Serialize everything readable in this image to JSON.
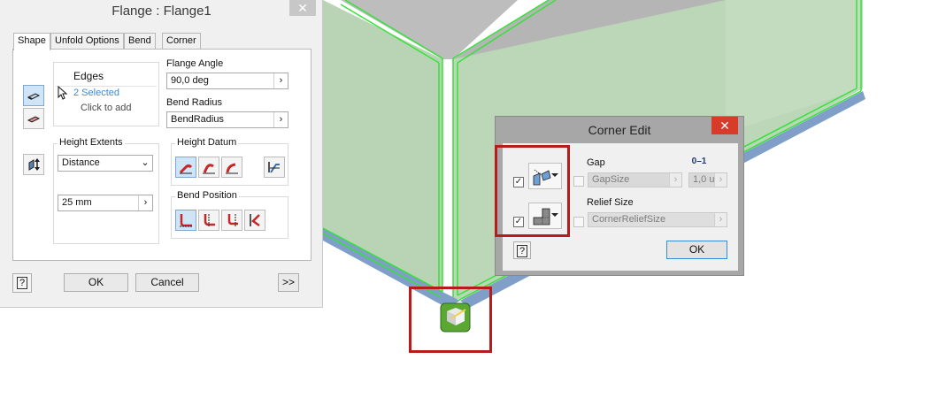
{
  "flange_dialog": {
    "title": "Flange : Flange1",
    "close_glyph": "✕",
    "tabs": [
      {
        "label": "Shape",
        "active": true
      },
      {
        "label": "Unfold Options",
        "active": false
      },
      {
        "label": "Bend",
        "active": false
      },
      {
        "label": "Corner",
        "active": false
      }
    ],
    "edges": {
      "header": "Edges",
      "selected": "2 Selected",
      "click_to_add": "Click to add"
    },
    "flange_angle": {
      "label": "Flange Angle",
      "value": "90,0 deg"
    },
    "bend_radius": {
      "label": "Bend Radius",
      "value": "BendRadius"
    },
    "height_extents": {
      "label": "Height Extents",
      "selected": "Distance",
      "distance_value": "25 mm"
    },
    "height_datum": {
      "label": "Height Datum"
    },
    "bend_position": {
      "label": "Bend Position"
    },
    "buttons": {
      "ok": "OK",
      "cancel": "Cancel",
      "more": ">>"
    },
    "help_glyph": "?"
  },
  "corner_edit": {
    "title": "Corner Edit",
    "close_glyph": "✕",
    "gap": {
      "label": "Gap",
      "value": "GapSize",
      "secondary_value": "1,0 u"
    },
    "relief_size": {
      "label": "Relief Size",
      "value": "CornerReliefSize"
    },
    "ok": "OK",
    "help_glyph": "?",
    "gap_icon_text": "0–1",
    "checkbox_glyph": "✓"
  },
  "colors": {
    "accent": "#3a8ad6",
    "highlight_box": "#b71c1c",
    "edge_green": "#36e23a",
    "face_green": "#b7d4b3",
    "glyph_green": "#5aa832"
  }
}
